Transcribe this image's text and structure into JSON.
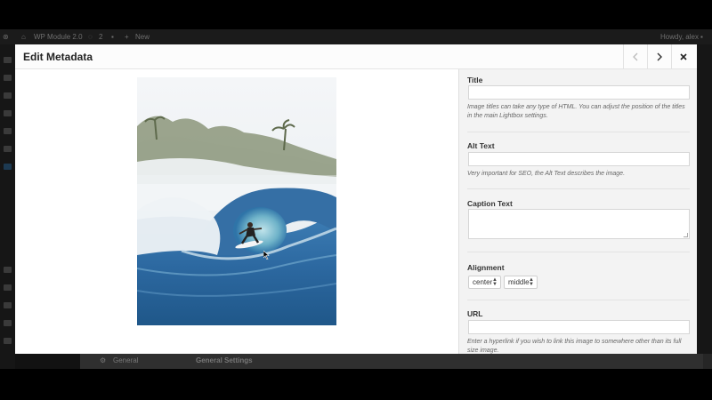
{
  "wp_admin": {
    "site_name": "WP Module 2.0",
    "comments_count": "2",
    "new_label": "New",
    "howdy": "Howdy, alex",
    "bottom_item": "General",
    "bottom_heading": "General Settings"
  },
  "modal": {
    "title": "Edit Metadata",
    "prev_icon": "chevron-left-icon",
    "next_icon": "chevron-right-icon",
    "close_icon": "close-icon"
  },
  "image": {
    "subject": "surfer-in-wave-barrel"
  },
  "form": {
    "title": {
      "label": "Title",
      "value": "",
      "help": "Image titles can take any type of HTML. You can adjust the position of the titles in the main Lightbox settings."
    },
    "alt_text": {
      "label": "Alt Text",
      "value": "",
      "help": "Very important for SEO, the Alt Text describes the image."
    },
    "caption": {
      "label": "Caption Text",
      "value": ""
    },
    "alignment": {
      "label": "Alignment",
      "horizontal": "center",
      "vertical": "middle"
    },
    "url": {
      "label": "URL",
      "value": "",
      "help": "Enter a hyperlink if you wish to link this image to somewhere other than its full size image."
    }
  },
  "colors": {
    "overlay": "#000000",
    "sidebar_bg": "#f3f3f3",
    "wave_blue": "#2f6fa8"
  }
}
